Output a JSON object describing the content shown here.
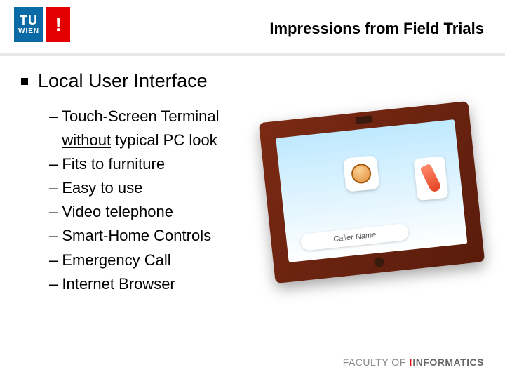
{
  "logo": {
    "top": "TU",
    "bottom": "WIEN",
    "bang": "!"
  },
  "title": "Impressions from Field Trials",
  "heading": "Local User Interface",
  "bullets": {
    "b0a": "Touch-Screen Terminal ",
    "b0b": "without",
    "b0c": " typical PC look",
    "b1": "Fits to furniture",
    "b2": "Easy to use",
    "b3": "Video telephone",
    "b4": "Smart-Home Controls",
    "b5": "Emergency Call",
    "b6": "Internet Browser"
  },
  "device": {
    "caller_label": "Caller Name"
  },
  "footer": {
    "faculty": "FACULTY OF ",
    "bang": "!",
    "informatics": "INFORMATICS"
  }
}
